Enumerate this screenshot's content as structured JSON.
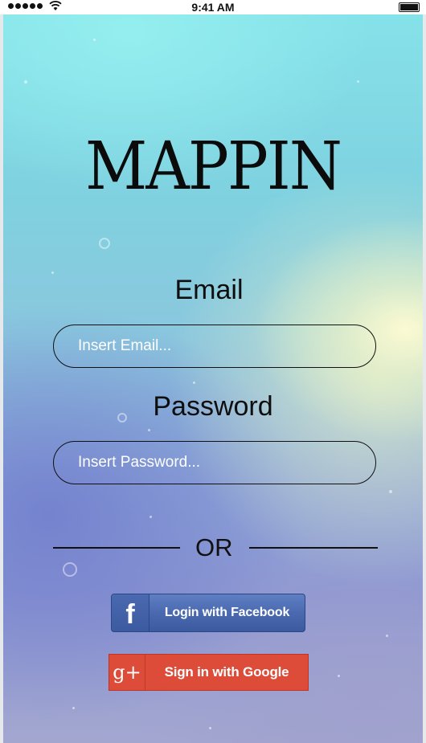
{
  "status_bar": {
    "time": "9:41 AM"
  },
  "app": {
    "title": "MAPPIN"
  },
  "login_form": {
    "email_label": "Email",
    "email_placeholder": "Insert Email...",
    "password_label": "Password",
    "password_placeholder": "Insert Password...",
    "separator": "OR"
  },
  "social_login": {
    "facebook_label": "Login with Facebook",
    "facebook_icon": "facebook-f-icon",
    "google_label": "Sign in with Google",
    "google_icon": "google-plus-icon"
  },
  "colors": {
    "facebook": "#3b5998",
    "google": "#dd4b39"
  }
}
